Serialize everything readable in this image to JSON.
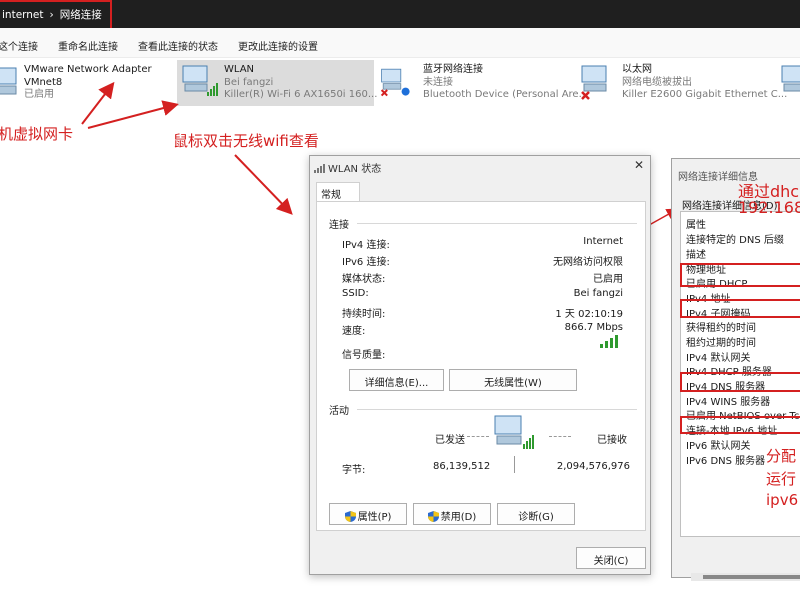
{
  "address_bar": {
    "crumb1": "internet",
    "sep": "›",
    "crumb2": "网络连接"
  },
  "command_bar": {
    "items": [
      "这个连接",
      "重命名此连接",
      "查看此连接的状态",
      "更改此连接的设置"
    ]
  },
  "adapters": [
    {
      "name": "VMware Network Adapter",
      "line2": "VMnet8",
      "line3": "已启用"
    },
    {
      "name": "WLAN",
      "line2": "Bei fangzi",
      "line3": "Killer(R) Wi-Fi 6 AX1650i 160..."
    },
    {
      "name": "蓝牙网络连接",
      "line2": "未连接",
      "line3": "Bluetooth Device (Personal Are..."
    },
    {
      "name": "以太网",
      "line2": "网络电缆被拔出",
      "line3": "Killer E2600 Gigabit Ethernet C..."
    }
  ],
  "annotations": {
    "vm": "机虚拟网卡",
    "wifi": "鼠标双击无线wifi查看",
    "dhcp": "通过dhc",
    "ip": "192.168",
    "assign": "分配",
    "run": "运行",
    "ipv6": "ipv6"
  },
  "wlan_dialog": {
    "title": "WLAN 状态",
    "close": "✕",
    "tab": "常规",
    "connection_group": "连接",
    "rows": [
      {
        "label": "IPv4 连接:",
        "value": "Internet"
      },
      {
        "label": "IPv6 连接:",
        "value": "无网络访问权限"
      },
      {
        "label": "媒体状态:",
        "value": "已启用"
      },
      {
        "label": "SSID:",
        "value": "Bei fangzi"
      },
      {
        "label": "持续时间:",
        "value": "1 天 02:10:19"
      },
      {
        "label": "速度:",
        "value": "866.7 Mbps"
      }
    ],
    "signal_label": "信号质量:",
    "details_btn": "详细信息(E)...",
    "wireless_btn": "无线属性(W)",
    "activity_group": "活动",
    "sent": "已发送",
    "received": "已接收",
    "bytes_label": "字节:",
    "bytes_sent": "86,139,512",
    "bytes_received": "2,094,576,976",
    "properties_btn": "属性(P)",
    "disable_btn": "禁用(D)",
    "diagnose_btn": "诊断(G)",
    "close_btn": "关闭(C)"
  },
  "details_window": {
    "title": "网络连接详细信息",
    "list_label": "网络连接详细信息(D):",
    "header": "属性",
    "items": [
      "连接特定的 DNS 后缀",
      "描述",
      "物理地址",
      "已启用 DHCP",
      "IPv4 地址",
      "IPv4 子网掩码",
      "获得租约的时间",
      "租约过期的时间",
      "IPv4 默认网关",
      "IPv4 DHCP 服务器",
      "IPv4 DNS 服务器",
      "IPv4 WINS 服务器",
      "已启用 NetBIOS over Tcpip",
      "连接-本地 IPv6 地址",
      "IPv6 默认网关",
      "IPv6 DNS 服务器"
    ]
  },
  "colors": {
    "accent": "#d42020",
    "signal": "#2f9a2f",
    "selection": "#dcdcdc"
  }
}
